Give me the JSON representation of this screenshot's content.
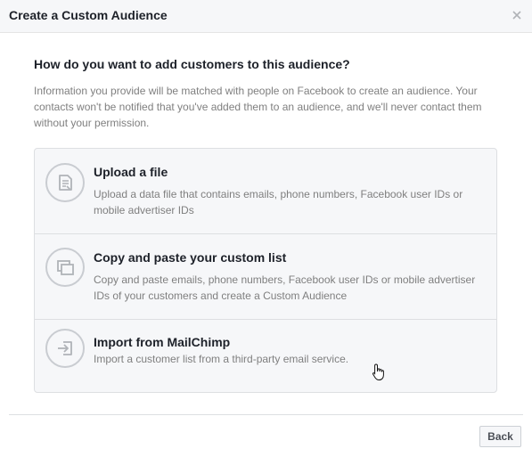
{
  "dialog": {
    "title": "Create a Custom Audience",
    "close_icon": "close-icon"
  },
  "main": {
    "question": "How do you want to add customers to this audience?",
    "description": "Information you provide will be matched with people on Facebook to create an audience. Your contacts won't be notified that you've added them to an audience, and we'll never contact them without your permission."
  },
  "options": [
    {
      "title": "Upload a file",
      "description": "Upload a data file that contains emails, phone numbers, Facebook user IDs or mobile advertiser IDs",
      "icon": "file-icon"
    },
    {
      "title": "Copy and paste your custom list",
      "description": "Copy and paste emails, phone numbers, Facebook user IDs or mobile advertiser IDs of your customers and create a Custom Audience",
      "icon": "copy-paste-icon"
    },
    {
      "title": "Import from MailChimp",
      "description": "Import a customer list from a third-party email service.",
      "icon": "import-icon"
    }
  ],
  "footer": {
    "back_label": "Back"
  },
  "colors": {
    "header_bg": "#f6f7f9",
    "option_bg": "#f6f7f9",
    "border": "#dddfe2",
    "title_text": "#1d2129",
    "muted_text": "#7f7f7f",
    "icon_stroke": "#b0b3b8"
  }
}
